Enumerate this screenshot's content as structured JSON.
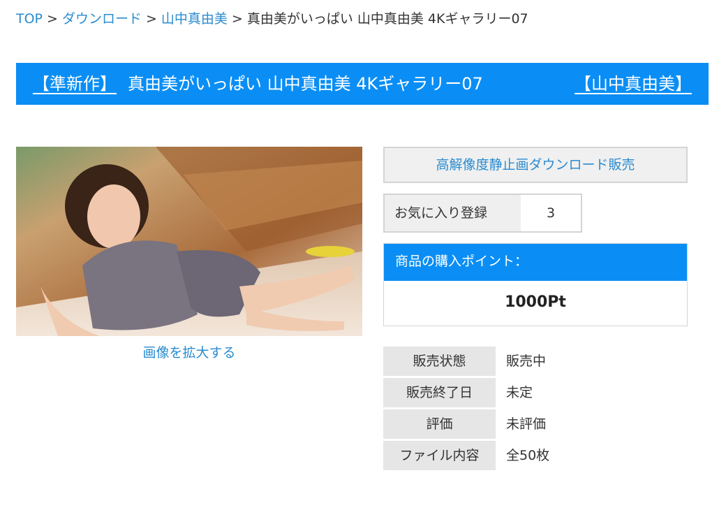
{
  "breadcrumb": {
    "items": [
      "TOP",
      "ダウンロード",
      "山中真由美"
    ],
    "separator": ">",
    "current": "真由美がいっぱい 山中真由美 4Kギャラリー07"
  },
  "title_bar": {
    "tag": "【準新作】",
    "title": "真由美がいっぱい 山中真由美 4Kギャラリー07",
    "actress_link": "【山中真由美】",
    "background_color": "#0a8ef5"
  },
  "product": {
    "zoom_link": "画像を拡大する"
  },
  "purchase": {
    "download_button": "高解像度静止画ダウンロード販売",
    "favorite_label": "お気に入り登録",
    "favorite_count": "3",
    "points_header": "商品の購入ポイント：",
    "points_value": "1000Pt"
  },
  "info": {
    "rows": [
      {
        "key": "販売状態",
        "value": "販売中"
      },
      {
        "key": "販売終了日",
        "value": "未定"
      },
      {
        "key": "評価",
        "value": "未評価"
      },
      {
        "key": "ファイル内容",
        "value": "全50枚"
      }
    ]
  },
  "colors": {
    "link": "#2a8bd0",
    "accent": "#0a8ef5"
  }
}
